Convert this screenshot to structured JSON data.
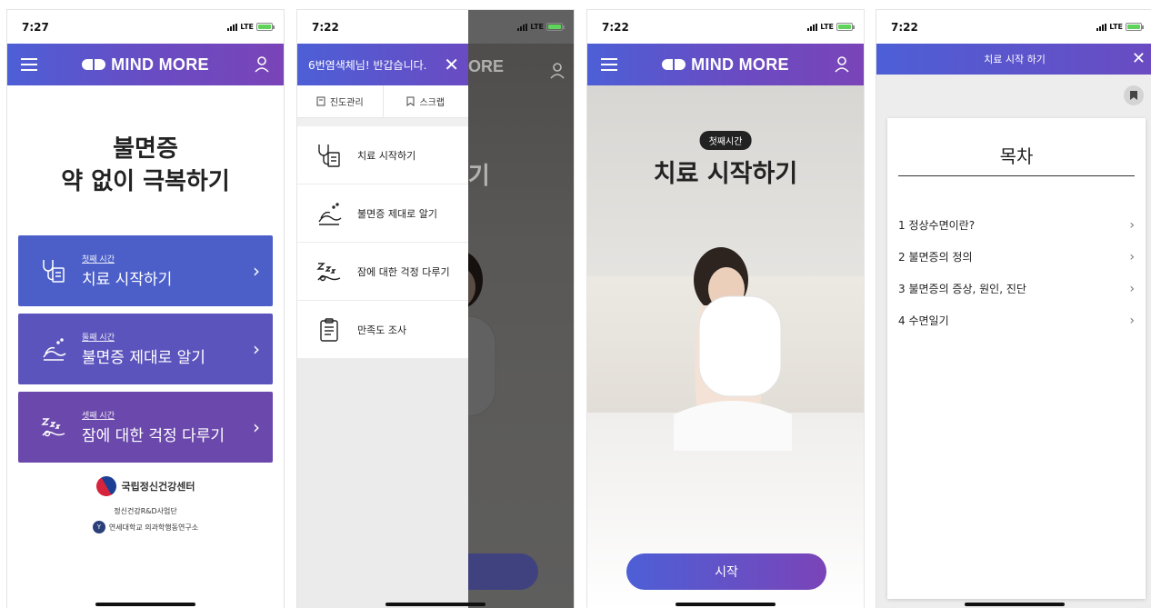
{
  "phone1": {
    "time": "7:27",
    "network": "LTE",
    "brand": "MIND MORE",
    "hero_line1": "불면증",
    "hero_line2": "약 없이 극복하기",
    "cards": [
      {
        "sub": "첫째 시간",
        "title": "치료 시작하기",
        "color": "#4c5fc9"
      },
      {
        "sub": "둘째 시간",
        "title": "불면증 제대로 알기",
        "color": "#5c54bd"
      },
      {
        "sub": "셋째 시간",
        "title": "잠에 대한 걱정 다루기",
        "color": "#6a48ac"
      }
    ],
    "org_main": "국립정신건강센터",
    "org_sub": "정신건강R&D사업단",
    "org_univ": "연세대학교 의과학행동연구소"
  },
  "phone2": {
    "time": "7:22",
    "network": "LTE",
    "greeting": "6번염색체님! 반갑습니다.",
    "tabs": [
      "진도관리",
      "스크랩"
    ],
    "items": [
      "치료 시작하기",
      "불면증 제대로 알기",
      "잠에 대한 걱정 다루기",
      "만족도 조사"
    ],
    "behind_brand": "ORE",
    "behind_title": "다루기"
  },
  "phone3": {
    "time": "7:22",
    "network": "LTE",
    "brand": "MIND MORE",
    "label": "첫째시간",
    "title": "치료 시작하기",
    "start": "시작"
  },
  "phone4": {
    "time": "7:22",
    "network": "LTE",
    "header": "치료 시작 하기",
    "toc_title": "목차",
    "toc": [
      "1 정상수면이란?",
      "2 불면증의 정의",
      "3 불면증의 증상, 원인, 진단",
      "4 수면일기"
    ]
  },
  "colors": {
    "accent_start": "#4d5fd6",
    "accent_end": "#7a44b8"
  }
}
